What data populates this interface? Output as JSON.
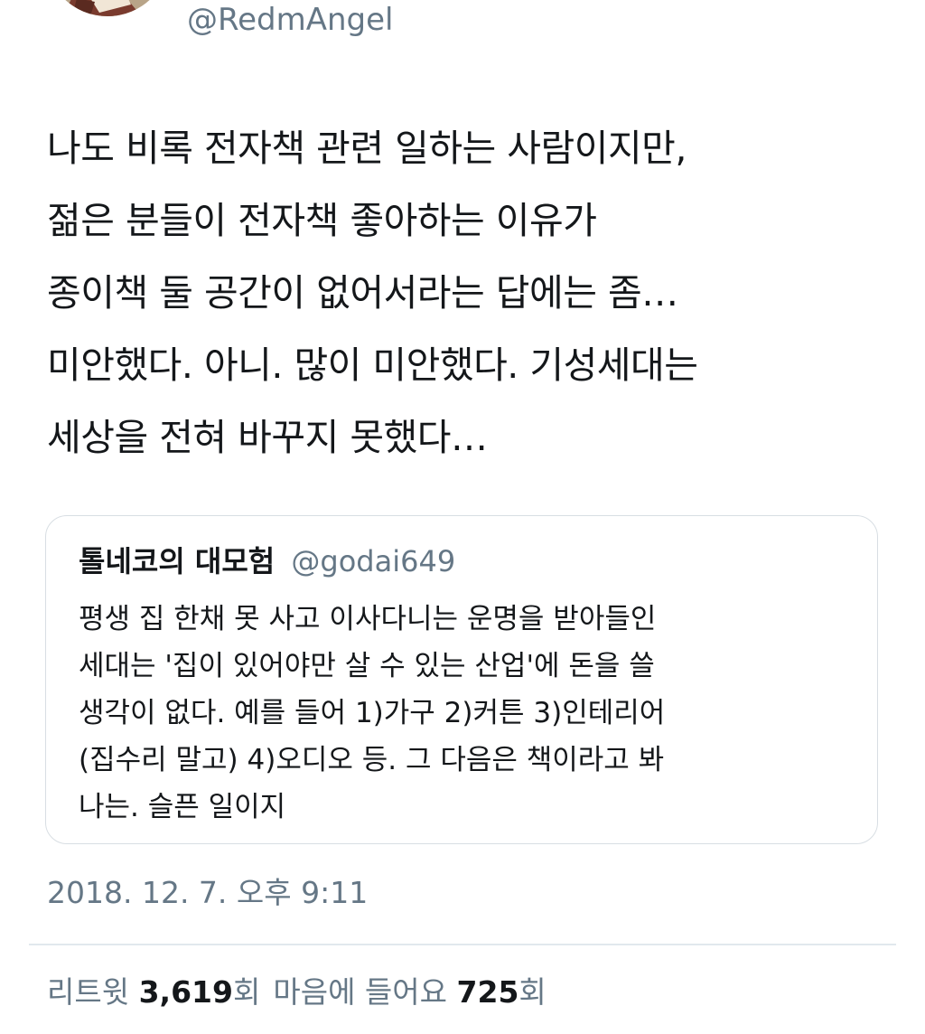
{
  "author": {
    "handle": "@RedmAngel"
  },
  "tweet": {
    "text": "나도 비록 전자책 관련 일하는 사람이지만,\n젊은 분들이 전자책 좋아하는 이유가\n종이책 둘 공간이 없어서라는 답에는 좀…\n미안했다. 아니. 많이 미안했다. 기성세대는\n세상을 전혀 바꾸지 못했다…"
  },
  "quoted_tweet": {
    "name": "톨네코의 대모험",
    "handle": "@godai649",
    "text": "평생 집 한채 못 사고 이사다니는 운명을 받아들인\n세대는 '집이 있어야만 살 수 있는 산업'에 돈을 쓸\n생각이 없다. 예를 들어 1)가구 2)커튼 3)인테리어\n(집수리 말고) 4)오디오 등. 그 다음은 책이라고 봐\n나는. 슬픈 일이지"
  },
  "timestamp": "2018. 12. 7. 오후 9:11",
  "stats": {
    "retweets_label": "리트윗",
    "retweets_count": "3,619",
    "retweets_unit": "회",
    "likes_label": "마음에 들어요",
    "likes_count": "725",
    "likes_unit": "회"
  }
}
